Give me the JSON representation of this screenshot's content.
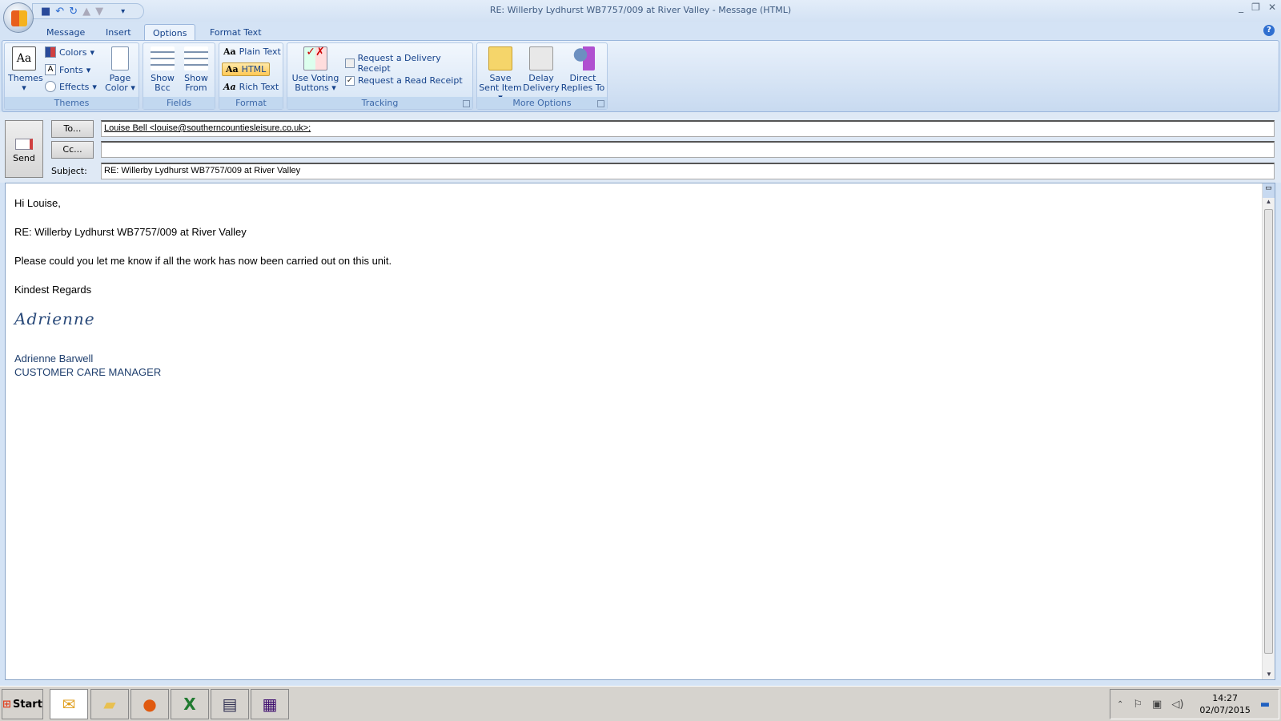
{
  "window": {
    "title": "RE: Willerby Lydhurst WB7757/009  at River Valley - Message (HTML)"
  },
  "tabs": [
    {
      "label": "Message"
    },
    {
      "label": "Insert"
    },
    {
      "label": "Options",
      "active": true
    },
    {
      "label": "Format Text"
    }
  ],
  "ribbon": {
    "themes": {
      "label": "Themes",
      "themes": "Themes",
      "colors": "Colors",
      "fonts": "Fonts",
      "effects": "Effects",
      "page_color": "Page Color"
    },
    "fields": {
      "label": "Fields",
      "show_bcc": "Show Bcc",
      "show_from": "Show From"
    },
    "format": {
      "label": "Format",
      "plain": "Plain Text",
      "html": "HTML",
      "rich": "Rich Text",
      "selected": "HTML"
    },
    "tracking": {
      "label": "Tracking",
      "voting": "Use Voting Buttons",
      "delivery_receipt": "Request a Delivery Receipt",
      "delivery_checked": false,
      "read_receipt": "Request a Read Receipt",
      "read_checked": true
    },
    "more": {
      "label": "More Options",
      "save_sent": "Save Sent Item",
      "delay": "Delay Delivery",
      "direct": "Direct Replies To"
    }
  },
  "header": {
    "send": "Send",
    "to_btn": "To...",
    "cc_btn": "Cc...",
    "subject_label": "Subject:",
    "to": "Louise Bell <louise@southerncountiesleisure.co.uk>;",
    "cc": "",
    "subject": "RE: Willerby Lydhurst WB7757/009  at River Valley"
  },
  "body": {
    "greeting": "Hi Louise,",
    "re_line": "RE: Willerby Lydhurst WB7757/009  at River Valley",
    "message": "Please could you let me know if all the work has now been carried out on this unit.",
    "closing": "Kindest Regards",
    "signature": "Adrienne",
    "name": "Adrienne Barwell",
    "title": "CUSTOMER CARE MANAGER"
  },
  "taskbar": {
    "start": "Start",
    "time": "14:27",
    "date": "02/07/2015"
  },
  "colors": {
    "accent": "#15428b",
    "ribbon": "#d4e3f5"
  }
}
